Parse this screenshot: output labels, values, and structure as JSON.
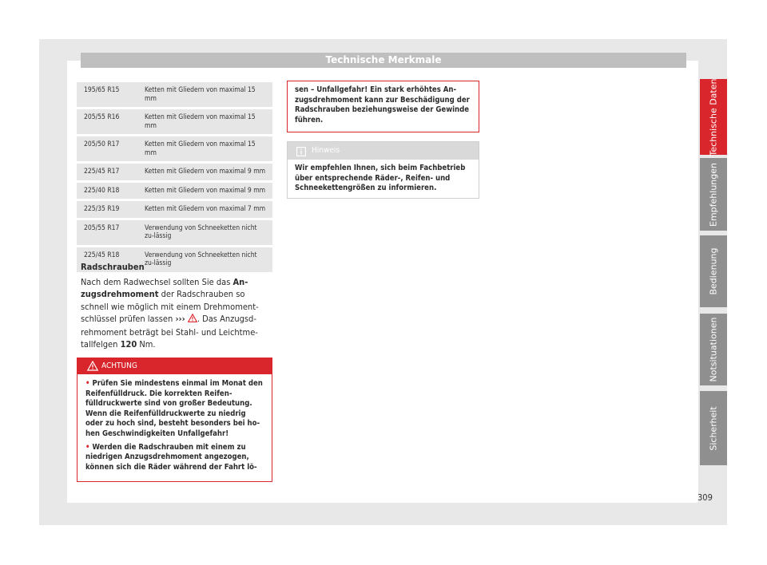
{
  "header": {
    "title": "Technische Merkmale"
  },
  "tire_table": {
    "rows": [
      {
        "size": "195/65 R15",
        "note": "Ketten mit Gliedern von maximal 15 mm"
      },
      {
        "size": "205/55 R16",
        "note": "Ketten mit Gliedern von maximal 15 mm"
      },
      {
        "size": "205/50 R17",
        "note": "Ketten mit Gliedern von maximal 15 mm"
      },
      {
        "size": "225/45 R17",
        "note": "Ketten mit Gliedern von maximal 9 mm"
      },
      {
        "size": "225/40 R18",
        "note": "Ketten mit Gliedern von maximal 9 mm"
      },
      {
        "size": "225/35 R19",
        "note": "Ketten mit Gliedern von maximal 7 mm"
      },
      {
        "size": "205/55 R17",
        "note": "Verwendung von Schneeketten nicht zu-lässig"
      },
      {
        "size": "225/45 R18",
        "note": "Verwendung von Schneeketten nicht zu-lässig"
      }
    ]
  },
  "section": {
    "title": "Radschrauben",
    "text_1": "Nach dem Radwechsel sollten Sie das ",
    "bold_1": "An-zugsdrehmoment",
    "text_2": " der Radschrauben so schnell wie möglich mit einem Drehmoment-schlüssel prüfen lassen ",
    "ref_arrows": "›››",
    "text_3": ". Das Anzugsd-rehmoment beträgt bei Stahl- und Leichtme-tallfelgen ",
    "bold_2": "120",
    "text_4": " Nm."
  },
  "warning": {
    "label": "ACHTUNG",
    "items": [
      "Prüfen Sie mindestens einmal im Monat den Reifenfülldruck. Die korrekten Reifen-fülldruckwerte sind von großer Bedeutung. Wenn die Reifenfülldruckwerte zu niedrig oder zu hoch sind, besteht besonders bei ho-hen Geschwindigkeiten Unfallgefahr!",
      "Werden die Radschrauben mit einem zu niedrigen Anzugsdrehmoment angezogen, können sich die Räder während der Fahrt lö-"
    ],
    "continuation": "sen – Unfallgefahr! Ein stark erhöhtes An-zugsdrehmoment kann zur Beschädigung der Radschrauben beziehungsweise der Gewinde führen."
  },
  "note": {
    "label": "Hinweis",
    "text": "Wir empfehlen Ihnen, sich beim Fachbetrieb über entsprechende Räder-, Reifen- und Schneekettengrößen zu informieren."
  },
  "side_tabs": [
    "Technische Daten",
    "Empfehlungen",
    "Bedienung",
    "Notsituationen",
    "Sicherheit"
  ],
  "colors": {
    "accent": "#d9262c",
    "tab_gray": "#8f8f8f",
    "header_gray": "#bfbfbf",
    "table_row": "#e6e6e6"
  },
  "page_number": "309"
}
